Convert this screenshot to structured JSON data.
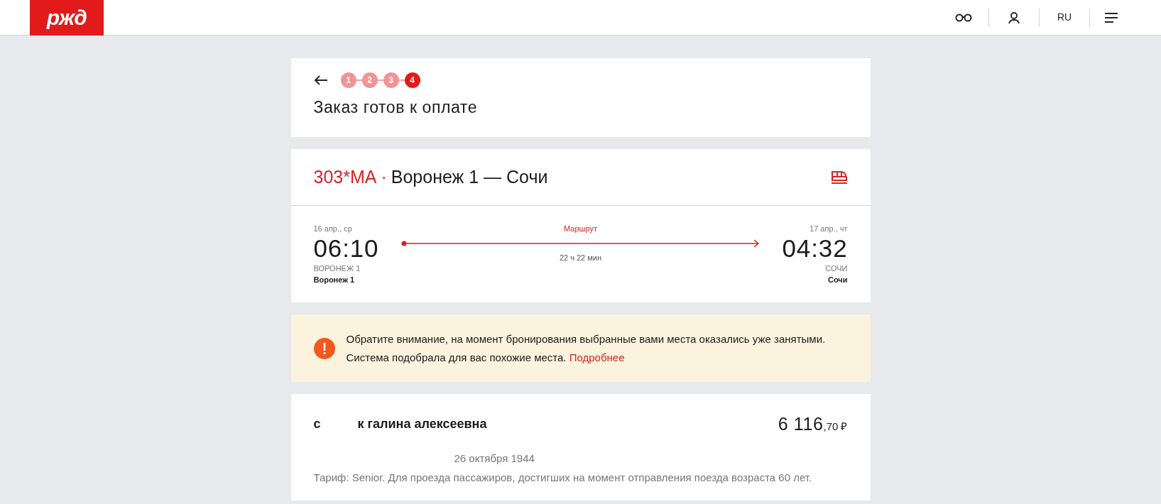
{
  "header": {
    "logo": "ржд",
    "language": "RU"
  },
  "order": {
    "steps": [
      {
        "label": "1",
        "selected": false
      },
      {
        "label": "2",
        "selected": false
      },
      {
        "label": "3",
        "selected": false
      },
      {
        "label": "4",
        "selected": true
      }
    ],
    "title": "Заказ готов к оплате"
  },
  "train": {
    "number": "303*МА",
    "separator": "·",
    "route": "Воронеж 1 — Сочи",
    "departure": {
      "date": "16 апр., ср",
      "time": "06:10",
      "station_code": "ВОРОНЕЖ 1",
      "station": "Воронеж 1"
    },
    "route_link": "Маршрут",
    "duration": "22 ч 22 мин",
    "arrival": {
      "date": "17 апр., чт",
      "time": "04:32",
      "station_code": "СОЧИ",
      "station": "Сочи"
    }
  },
  "notice": {
    "text": "Обратите внимание, на момент бронирования выбранные вами места оказались уже занятыми. Система подобрала для вас похожие места.",
    "link": "Подробнее"
  },
  "passenger": {
    "name_parts": [
      "с",
      "к галина алексеевна"
    ],
    "price": "6 116",
    "price_fraction": ",70 ₽",
    "birth_date": "26 октября 1944",
    "tariff": "Тариф: Senior. Для проезда пассажиров, достигших на момент отправления поезда возраста 60 лет."
  }
}
